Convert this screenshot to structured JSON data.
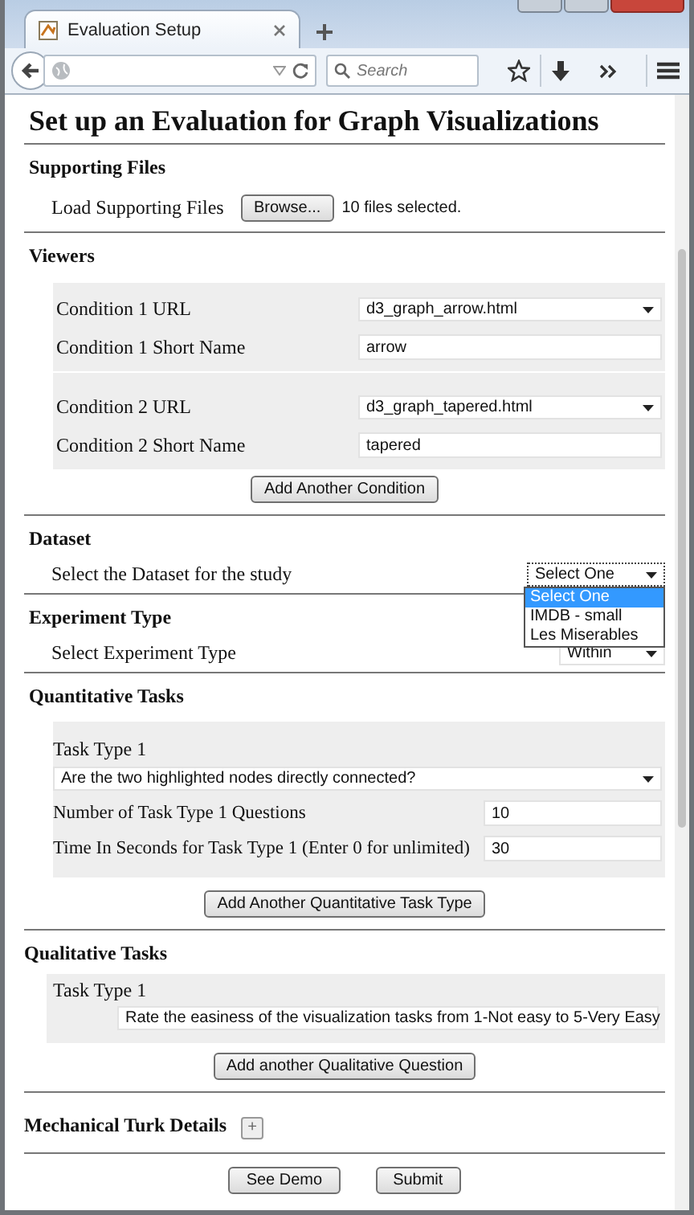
{
  "browser": {
    "tab_title": "Evaluation Setup",
    "search_placeholder": "Search"
  },
  "title": "Set up an Evaluation for Graph Visualizations",
  "sections": [
    {
      "kind": "files",
      "heading": "Supporting Files",
      "label": "Load Supporting Files",
      "button": "Browse...",
      "status": "10 files selected."
    },
    {
      "kind": "viewers",
      "heading": "Viewers",
      "conditions": [
        {
          "url_label": "Condition 1 URL",
          "url": "d3_graph_arrow.html",
          "name_label": "Condition 1 Short Name",
          "name": "arrow"
        },
        {
          "url_label": "Condition 2 URL",
          "url": "d3_graph_tapered.html",
          "name_label": "Condition 2 Short Name",
          "name": "tapered"
        }
      ],
      "button": "Add Another Condition"
    },
    {
      "kind": "dataset",
      "heading": "Dataset",
      "label": "Select the Dataset for the study",
      "value": "Select One",
      "expanded": true,
      "options": [
        {
          "label": "Select One",
          "selected": true
        },
        {
          "label": "IMDB - small",
          "selected": false
        },
        {
          "label": "Les Miserables",
          "selected": false
        }
      ]
    },
    {
      "kind": "experiment",
      "heading": "Experiment Type",
      "label": "Select Experiment Type",
      "value": "Within"
    },
    {
      "kind": "quantitative",
      "heading": "Quantitative Tasks",
      "tasks": [
        {
          "label": "Task Type 1",
          "question": "Are the two highlighted nodes directly connected?",
          "fields": [
            {
              "label": "Number of Task Type 1 Questions",
              "value": "10"
            },
            {
              "label": "Time In Seconds for Task Type 1 (Enter 0 for unlimited)",
              "value": "30"
            }
          ]
        }
      ],
      "button": "Add Another Quantitative Task Type"
    },
    {
      "kind": "qualitative",
      "heading": "Qualitative Tasks",
      "tasks": [
        {
          "label": "Task Type 1",
          "question": "Rate the easiness of the visualization tasks from 1-Not easy to 5-Very Easy"
        }
      ],
      "button": "Add another Qualitative Question"
    },
    {
      "kind": "mturk",
      "heading": "Mechanical Turk Details",
      "toggle": "+"
    }
  ],
  "actions": [
    "See Demo",
    "Submit"
  ]
}
